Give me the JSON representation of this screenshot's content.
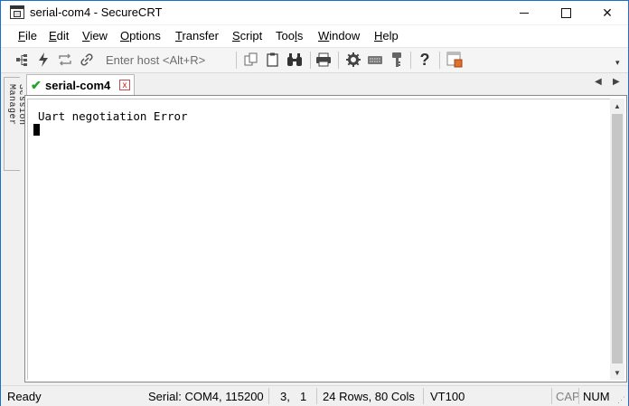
{
  "window": {
    "title": "serial-com4 - SecureCRT"
  },
  "menu": [
    {
      "label": "File"
    },
    {
      "label": "Edit"
    },
    {
      "label": "View"
    },
    {
      "label": "Options"
    },
    {
      "label": "Transfer"
    },
    {
      "label": "Script"
    },
    {
      "label": "Tools"
    },
    {
      "label": "Window"
    },
    {
      "label": "Help"
    }
  ],
  "toolbar": {
    "host_placeholder": "Enter host <Alt+R>",
    "icons": [
      "connect-tree-icon",
      "quick-connect-icon",
      "reconnect-icon",
      "disconnect-icon",
      "copy-icon",
      "paste-icon",
      "find-icon",
      "print-icon",
      "settings-icon",
      "keymap-icon",
      "key-icon",
      "help-icon",
      "sftp-icon"
    ]
  },
  "sidebar": {
    "session_manager_label": "Session Manager"
  },
  "tabs": [
    {
      "label": "serial-com4",
      "close": "x",
      "status": "connected"
    }
  ],
  "terminal": {
    "lines": [
      "Uart negotiation Error"
    ]
  },
  "status": {
    "ready": "Ready",
    "connection": "Serial: COM4, 115200",
    "row": "3,",
    "col": "1",
    "size": "24 Rows, 80 Cols",
    "emulation": "VT100",
    "cap": "CAP",
    "num": "NUM"
  },
  "colors": {
    "tab_check": "#22a32a",
    "window_border": "#1c6fd0",
    "tab_close": "#c22222"
  }
}
